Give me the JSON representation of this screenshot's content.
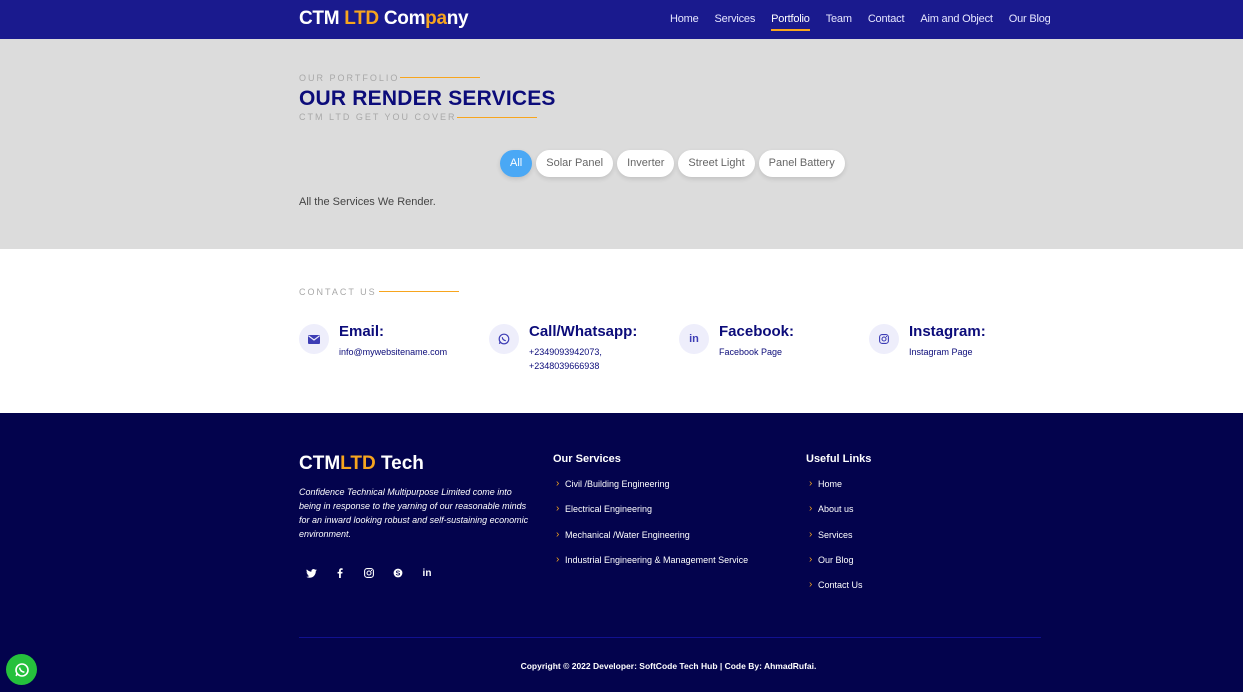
{
  "header": {
    "logo": {
      "part1": "CTM ",
      "part2": "LTD",
      "part3": " Com",
      "part4": "pa",
      "part5": "ny"
    },
    "nav": [
      "Home",
      "Services",
      "Portfolio",
      "Team",
      "Contact",
      "Aim and Object",
      "Our Blog"
    ],
    "active_nav": "Portfolio"
  },
  "portfolio": {
    "eyebrow": "OUR PORTFOLIO",
    "title": "OUR RENDER SERVICES",
    "subtitle": "CTM LTD GET YOU COVER",
    "filters": [
      "All",
      "Solar Panel",
      "Inverter",
      "Street Light",
      "Panel Battery"
    ],
    "active_filter": "All",
    "description": "All the Services We Render."
  },
  "contact": {
    "eyebrow": "CONTACT US",
    "items": [
      {
        "title": "Email:",
        "value": "info@mywebsitename.com",
        "icon": "envelope-icon"
      },
      {
        "title": "Call/Whatsapp:",
        "value": "+2349093942073,",
        "value2": "+2348039666938",
        "icon": "whatsapp-icon"
      },
      {
        "title": "Facebook:",
        "value": "Facebook Page",
        "icon": "linkedin-icon"
      },
      {
        "title": "Instagram:",
        "value": "Instagram Page",
        "icon": "instagram-icon"
      }
    ]
  },
  "footer": {
    "logo": {
      "part1": "CTM",
      "part2": "LTD",
      "part3": " Tech"
    },
    "about": "Confidence Technical Multipurpose Limited come into being in response to the yarning of our reasonable minds for an inward looking robust and self-sustaining economic environment.",
    "socials": [
      "twitter-icon",
      "facebook-icon",
      "instagram-icon",
      "skype-icon",
      "linkedin-icon"
    ],
    "services_title": "Our Services",
    "services": [
      "Civil /Building Engineering",
      "Electrical Engineering",
      "Mechanical /Water Engineering",
      "Industrial Engineering & Management Service"
    ],
    "links_title": "Useful Links",
    "links": [
      "Home",
      "About us",
      "Services",
      "Our Blog",
      "Contact Us"
    ],
    "copyright": "Copyright © 2022 Developer: SoftCode Tech Hub | Code By: AhmadRufai."
  },
  "colors": {
    "header_bg": "#1a1a8e",
    "accent_orange": "#f7a51e",
    "portfolio_bg": "#dcdcdc",
    "title_navy": "#0c0c7a",
    "footer_bg": "#03034d",
    "filter_active": "#4aa8f5",
    "whatsapp_green": "#25c13c"
  }
}
